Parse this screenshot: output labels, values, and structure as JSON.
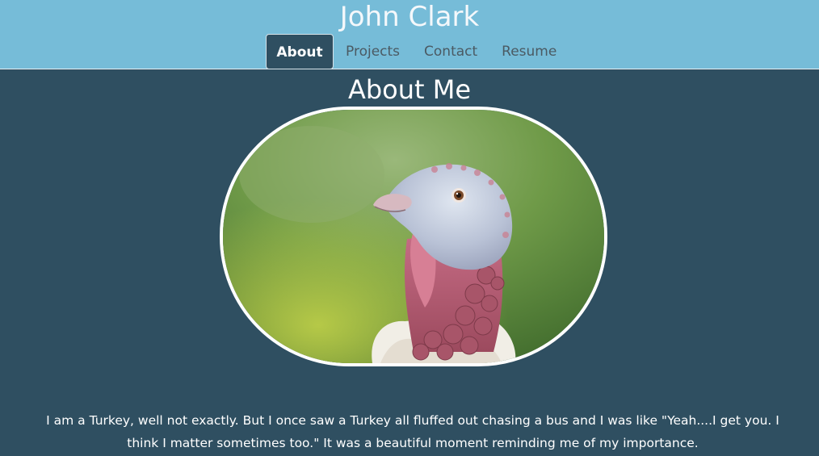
{
  "site": {
    "title": "John Clark"
  },
  "nav": {
    "items": [
      {
        "label": "About",
        "active": true
      },
      {
        "label": "Projects",
        "active": false
      },
      {
        "label": "Contact",
        "active": false
      },
      {
        "label": "Resume",
        "active": false
      }
    ]
  },
  "about": {
    "heading": "About Me",
    "bio": "I am a Turkey, well not exactly. But I once saw a Turkey all fluffed out chasing a bus and I was like \"Yeah....I get you. I think I matter sometimes too.\" It was a beautiful moment reminding me of my importance."
  },
  "colors": {
    "header_bg": "#76bcd8",
    "page_bg": "#2f4f61",
    "nav_active_bg": "#2f4f61",
    "nav_text": "#4b5a63"
  }
}
